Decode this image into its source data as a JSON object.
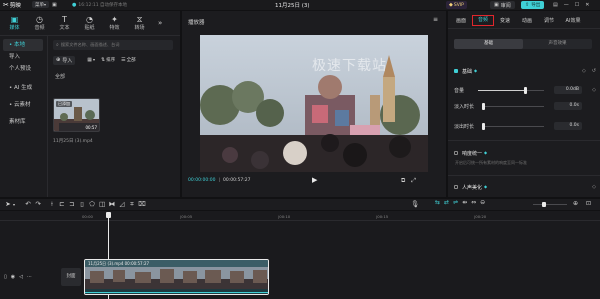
{
  "app": {
    "logo_text": "剪映",
    "menu_label": "菜单",
    "project_title": "11月25日 (3)",
    "autosave_text": "16:12:11 自动保存本地",
    "vip_label": "SVIP",
    "share_label": "审阅",
    "export_label": "导出"
  },
  "toolbar_tabs": [
    {
      "label": "媒体",
      "icon": "media-icon"
    },
    {
      "label": "音频",
      "icon": "audio-icon"
    },
    {
      "label": "文本",
      "icon": "text-icon"
    },
    {
      "label": "贴纸",
      "icon": "sticker-icon"
    },
    {
      "label": "特效",
      "icon": "effects-icon"
    },
    {
      "label": "转场",
      "icon": "transition-icon"
    }
  ],
  "media_sidebar": [
    {
      "label": "• 本地"
    },
    {
      "label": "导入"
    },
    {
      "label": "个人预设"
    },
    {
      "label": "• AI 生成"
    },
    {
      "label": "• 云素材"
    },
    {
      "label": "素材库"
    }
  ],
  "media": {
    "search_placeholder": "搜索文件名称、画面描述、台词",
    "import_label": "导入",
    "sort_label": "排序",
    "all_label": "全部",
    "filter_label": "全部",
    "clip_badge": "已添加",
    "clip_duration": "00:57",
    "clip_name": "11月25日 (3).mp4"
  },
  "player": {
    "title": "播放器",
    "watermark": "极速下载站",
    "current_time": "00:00:00:00",
    "total_time": "00:00:57:27",
    "ratio_label": "比例"
  },
  "props_tabs": [
    "画面",
    "音频",
    "变速",
    "动画",
    "调节",
    "AI效果"
  ],
  "props": {
    "subtabs": [
      "基础",
      "声音效果"
    ],
    "section_basic": "基础",
    "volume_label": "音量",
    "volume_value": "0.0dB",
    "volume_level": 0.72,
    "fadein_label": "淡入时长",
    "fadein_value": "0.0s",
    "fadeout_label": "淡出时长",
    "fadeout_value": "0.0s",
    "loudness_label": "响度统一",
    "loudness_desc": "开启后可统一所有素材的响度至同一标准",
    "voice_label": "人声美化",
    "accent_color": "#3fd0d6",
    "highlight_color": "#e0262c"
  },
  "timeline": {
    "ruler_labels": [
      "00:00",
      "|00:05",
      "|00:10",
      "|00:15",
      "|00:20",
      "|00:25",
      "|00:30"
    ],
    "clip_label": "11月25日 (3).mp4  00:00:57:27",
    "cover_label": "封面"
  }
}
